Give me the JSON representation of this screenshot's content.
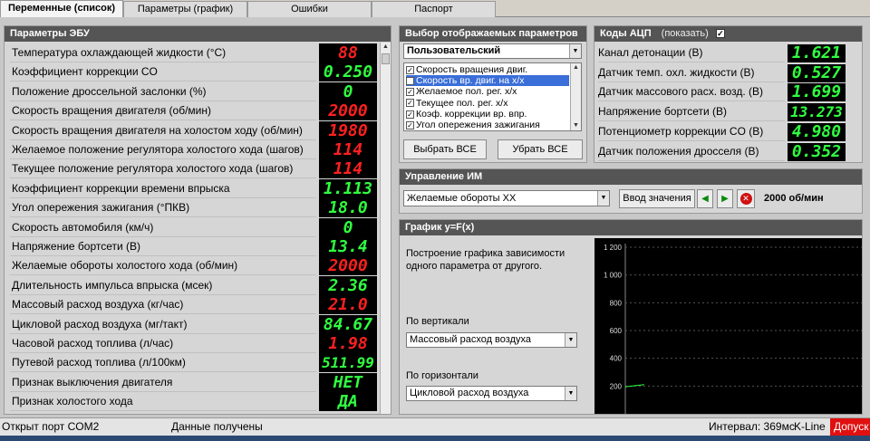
{
  "tabs": [
    {
      "label": "Переменные (список)",
      "active": true
    },
    {
      "label": "Параметры (график)",
      "active": false
    },
    {
      "label": "Ошибки",
      "active": false
    },
    {
      "label": "Паспорт",
      "active": false
    }
  ],
  "ecu": {
    "title": "Параметры ЭБУ",
    "rows": [
      {
        "label": "Температура охлаждающей жидкости (°C)",
        "value": "88",
        "color": "red"
      },
      {
        "label": "Коэффициент коррекции CO",
        "value": "0.250",
        "color": "green"
      },
      {
        "label": "Положение дроссельной заслонки (%)",
        "value": "0",
        "color": "green"
      },
      {
        "label": "Скорость вращения двигателя (об/мин)",
        "value": "2000",
        "color": "red"
      },
      {
        "label": "Скорость вращения двигателя на холостом ходу (об/мин)",
        "value": "1980",
        "color": "red"
      },
      {
        "label": "Желаемое положение регулятора холостого хода (шагов)",
        "value": "114",
        "color": "red"
      },
      {
        "label": "Текущее положение регулятора холостого хода (шагов)",
        "value": "114",
        "color": "red"
      },
      {
        "label": "Коэффициент коррекции времени впрыска",
        "value": "1.113",
        "color": "green"
      },
      {
        "label": "Угол опережения зажигания (°ПКВ)",
        "value": "18.0",
        "color": "green"
      },
      {
        "label": "Скорость автомобиля (км/ч)",
        "value": "0",
        "color": "green"
      },
      {
        "label": "Напряжение бортсети (В)",
        "value": "13.4",
        "color": "green"
      },
      {
        "label": "Желаемые обороты холостого хода (об/мин)",
        "value": "2000",
        "color": "red"
      },
      {
        "label": "Длительность импульса впрыска (мсек)",
        "value": "2.36",
        "color": "green"
      },
      {
        "label": "Массовый расход воздуха (кг/час)",
        "value": "21.0",
        "color": "red"
      },
      {
        "label": "Цикловой расход воздуха (мг/такт)",
        "value": "84.67",
        "color": "green"
      },
      {
        "label": "Часовой расход топлива (л/час)",
        "value": "1.98",
        "color": "red"
      },
      {
        "label": "Путевой расход топлива (л/100км)",
        "value": "511.99",
        "color": "green"
      },
      {
        "label": "Признак выключения двигателя",
        "value": "НЕТ",
        "color": "green"
      },
      {
        "label": "Признак холостого хода",
        "value": "ДА",
        "color": "green"
      }
    ]
  },
  "select_params": {
    "title": "Выбор отображаемых параметров",
    "preset": "Пользовательский",
    "items": [
      {
        "label": "Скорость вращения двиг.",
        "checked": true,
        "selected": false
      },
      {
        "label": "Скорость вр. двиг. на х/х",
        "checked": true,
        "selected": true
      },
      {
        "label": "Желаемое пол. рег. х/х",
        "checked": true,
        "selected": false
      },
      {
        "label": "Текущее пол. рег. х/х",
        "checked": true,
        "selected": false
      },
      {
        "label": "Коэф. коррекции вр. впр.",
        "checked": true,
        "selected": false
      },
      {
        "label": "Угол опережения зажигания",
        "checked": true,
        "selected": false
      }
    ],
    "select_all": "Выбрать ВСЕ",
    "remove_all": "Убрать ВСЕ"
  },
  "adc": {
    "title": "Коды АЦП",
    "show_label": "(показать)",
    "show_checked": true,
    "rows": [
      {
        "label": "Канал детонации (В)",
        "value": "1.621"
      },
      {
        "label": "Датчик темп. охл. жидкости (В)",
        "value": "0.527"
      },
      {
        "label": "Датчик массового расх. возд. (В)",
        "value": "1.699"
      },
      {
        "label": "Напряжение бортсети (В)",
        "value": "13.273"
      },
      {
        "label": "Потенциометр коррекции CO (В)",
        "value": "4.980"
      },
      {
        "label": "Датчик положения дросселя (В)",
        "value": "0.352"
      }
    ]
  },
  "control": {
    "title": "Управление ИМ",
    "selected": "Желаемые обороты ХХ",
    "input_button": "Ввод значения",
    "value_text": "2000 об/мин"
  },
  "graph": {
    "title": "График y=F(x)",
    "description": "Построение графика зависимости одного параметра от другого.",
    "vertical_label": "По вертикали",
    "vertical_value": "Массовый расход воздуха",
    "horizontal_label": "По горизонтали",
    "horizontal_value": "Цикловой расход воздуха"
  },
  "chart_data": {
    "type": "line",
    "y_ticks": [
      "1 200",
      "1 000",
      "800",
      "600",
      "400",
      "200"
    ],
    "ylim": [
      0,
      1200
    ],
    "series": [
      {
        "values": [
          [
            0.0,
            195
          ],
          [
            0.08,
            210
          ]
        ]
      }
    ]
  },
  "status": {
    "port": "Открыт порт COM2",
    "data": "Данные получены",
    "interval": "Интервал: 369мс",
    "interface": "K-Line",
    "alert": "Допуск"
  },
  "colors": {
    "lcd_red": "#ff2020",
    "lcd_green": "#30ff40",
    "header": "#555555",
    "alert": "#e01010"
  }
}
